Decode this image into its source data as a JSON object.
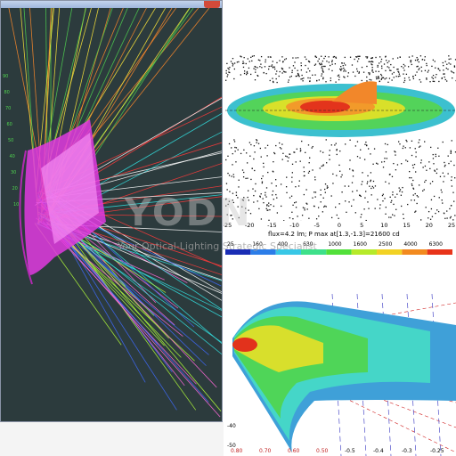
{
  "window": {
    "close_icon": "close-icon"
  },
  "left_plot": {
    "axis_ticks": [
      "90",
      "80",
      "70",
      "60",
      "50",
      "40",
      "30",
      "20",
      "10"
    ],
    "background": "#2c3b3d",
    "reflector_color": "#e23be0"
  },
  "iso_plot": {
    "x_ticks": [
      "-25",
      "-20",
      "-15",
      "-10",
      "-5",
      "0",
      "5",
      "10",
      "15",
      "20",
      "25"
    ],
    "caption": "flux=4.2 lm; P max at[1.3,-1.3]=21600 cd",
    "scale_values": [
      "25",
      "160",
      "400",
      "630",
      "1000",
      "1600",
      "2500",
      "4000",
      "6300"
    ],
    "scale_colors": [
      "#1a2db5",
      "#2c7de8",
      "#38c7e6",
      "#3ee08a",
      "#52e03a",
      "#b6ea2a",
      "#f2d224",
      "#f28a1f",
      "#e8341a"
    ]
  },
  "side_plot": {
    "y_ticks": [
      "-40",
      "-50"
    ],
    "x_labels": [
      "0.80",
      "0.70",
      "0.60",
      "0.50",
      "-0.5",
      "-0.4",
      "-0.3",
      "-0.25"
    ]
  },
  "watermark": {
    "big_text": "YODN",
    "small_text": "Your Optical-Lighting Strategic Specialist"
  }
}
